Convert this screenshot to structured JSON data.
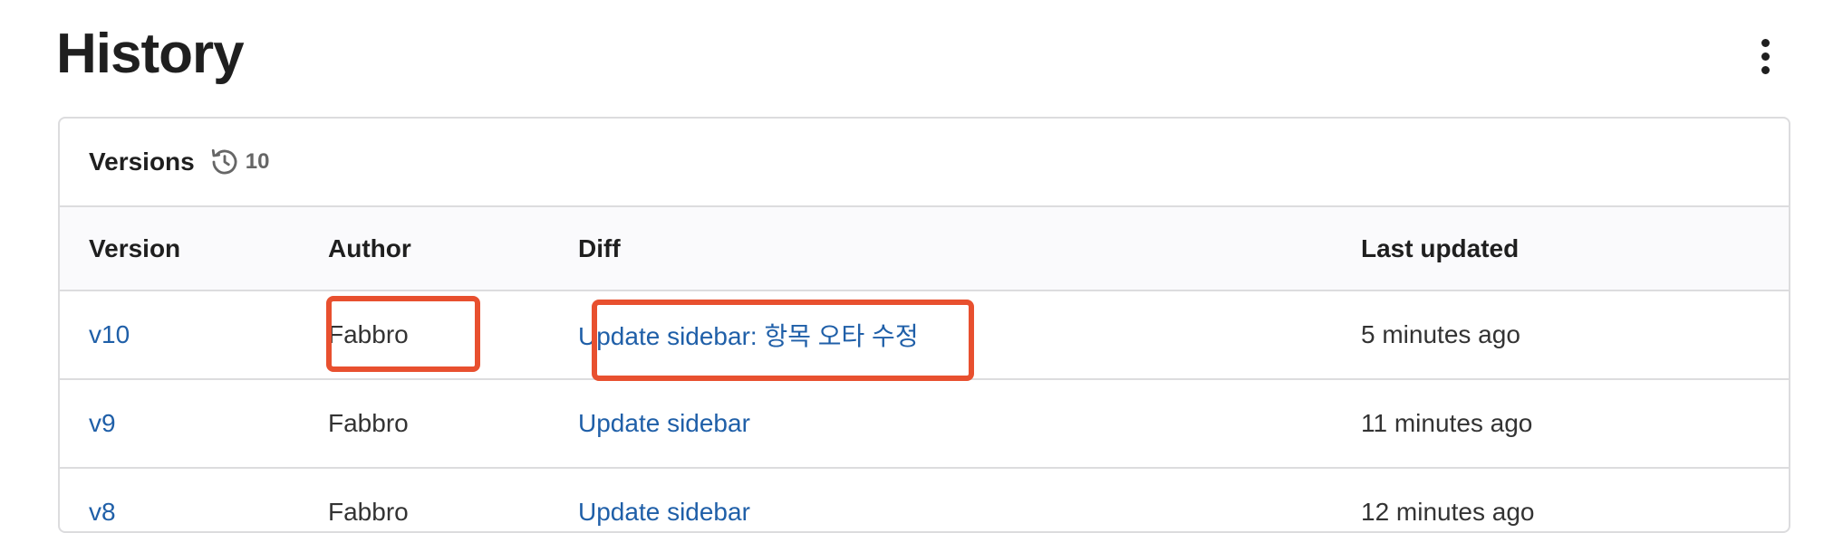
{
  "page": {
    "title": "History"
  },
  "more_menu": {
    "icon": "kebab-vertical-icon"
  },
  "versions_card": {
    "title": "Versions",
    "count_icon": "history-icon",
    "count": "10"
  },
  "table": {
    "headers": [
      "Version",
      "Author",
      "Diff",
      "Last updated"
    ],
    "rows": [
      {
        "version": "v10",
        "author": "Fabbro",
        "diff": "Update sidebar: 항목 오타 수정",
        "updated": "5 minutes ago"
      },
      {
        "version": "v9",
        "author": "Fabbro",
        "diff": "Update sidebar",
        "updated": "11 minutes ago"
      },
      {
        "version": "v8",
        "author": "Fabbro",
        "diff": "Update sidebar",
        "updated": "12 minutes ago"
      }
    ]
  },
  "highlight_color": "#e8502f",
  "link_color": "#1f5fa8"
}
